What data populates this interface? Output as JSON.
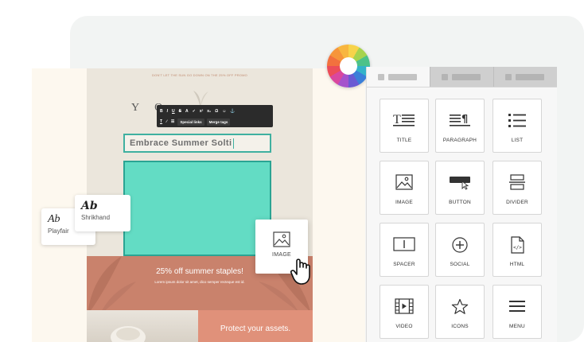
{
  "email": {
    "preheader": "DON'T LET THE SUN GO DOWN ON THE 25% OFF PROMO",
    "logo_text": "Y O",
    "title_text": "Embrace Summer Solti",
    "promo_title": "25% off summer staples!",
    "promo_body": "Lorem ipsum dolor sit amet, dico semper recteque est id.",
    "cta_text": "Protect your assets."
  },
  "toolbar": {
    "row1": [
      "B",
      "I",
      "U",
      "S",
      "A",
      "✓",
      "x²",
      "x₂",
      "Ω",
      "☺",
      "⚓"
    ],
    "row2_icons": [
      "T",
      "∕",
      "☰"
    ],
    "special_links": "Special links",
    "merge_tags": "Merge tags"
  },
  "fonts": {
    "playfair": {
      "sample": "Ab",
      "name": "Playfair"
    },
    "shrikhand": {
      "sample": "Ab",
      "name": "Shrikhand"
    }
  },
  "drag_card": {
    "label": "IMAGE"
  },
  "blocks": [
    {
      "label": "TITLE",
      "icon": "title-icon"
    },
    {
      "label": "PARAGRAPH",
      "icon": "paragraph-icon"
    },
    {
      "label": "LIST",
      "icon": "list-icon"
    },
    {
      "label": "IMAGE",
      "icon": "image-icon"
    },
    {
      "label": "BUTTON",
      "icon": "button-icon"
    },
    {
      "label": "DIVIDER",
      "icon": "divider-icon"
    },
    {
      "label": "SPACER",
      "icon": "spacer-icon"
    },
    {
      "label": "SOCIAL",
      "icon": "social-icon"
    },
    {
      "label": "HTML",
      "icon": "html-icon"
    },
    {
      "label": "VIDEO",
      "icon": "video-icon"
    },
    {
      "label": "ICONS",
      "icon": "star-icon"
    },
    {
      "label": "MENU",
      "icon": "menu-icon"
    }
  ],
  "colors": {
    "teal": "#63dcc4",
    "teal_border": "#2aa493",
    "terracotta": "#c9826c",
    "salmon": "#e0917a"
  }
}
